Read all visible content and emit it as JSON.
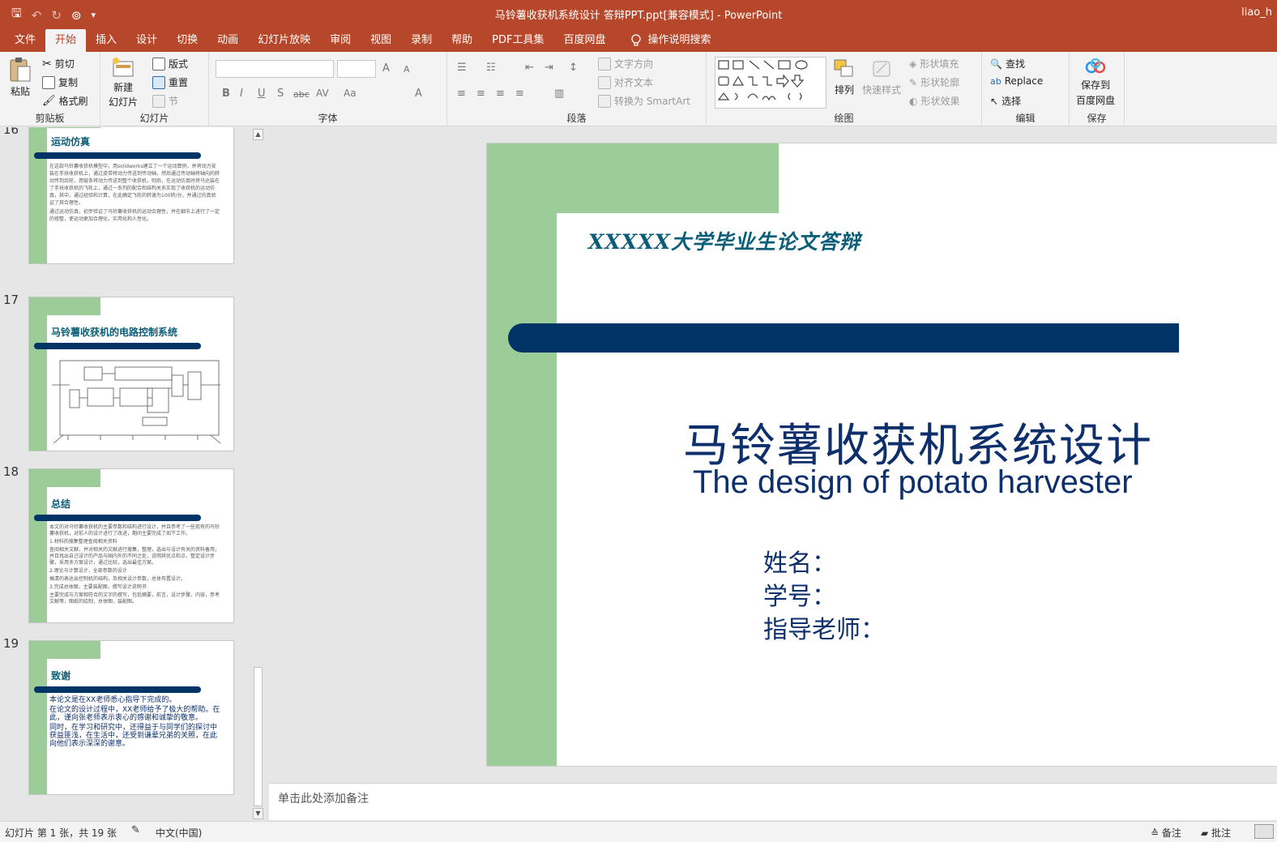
{
  "window": {
    "title": "马铃薯收获机系统设计 答辩PPT.ppt[兼容模式]  -  PowerPoint",
    "user": "liao_h"
  },
  "qat": {
    "save": "🖫",
    "undo": "↶",
    "redo": "↻",
    "present": "⊚",
    "more": "▾"
  },
  "tabs": [
    "文件",
    "开始",
    "插入",
    "设计",
    "切换",
    "动画",
    "幻灯片放映",
    "审阅",
    "视图",
    "录制",
    "帮助",
    "PDF工具集",
    "百度网盘"
  ],
  "active_tab": "开始",
  "tellme": "操作说明搜索",
  "ribbon": {
    "clipboard": {
      "label": "剪贴板",
      "paste": "粘贴",
      "cut": "剪切",
      "copy": "复制",
      "format_painter": "格式刷"
    },
    "slides": {
      "label": "幻灯片",
      "new_slide_1": "新建",
      "new_slide_2": "幻灯片",
      "layout": "版式",
      "reset": "重置",
      "section": "节"
    },
    "font": {
      "label": "字体",
      "bold": "B",
      "italic": "I",
      "underline": "U",
      "shadow": "S",
      "strike": "abc",
      "spacing": "AV",
      "case": "Aa",
      "color": "A",
      "grow": "A",
      "shrink": "A"
    },
    "paragraph": {
      "label": "段落",
      "text_direction": "文字方向",
      "align_text": "对齐文本",
      "smartart": "转换为 SmartArt"
    },
    "drawing": {
      "label": "绘图",
      "arrange": "排列",
      "quick_styles": "快速样式",
      "fill": "形状填充",
      "outline": "形状轮廓",
      "effects": "形状效果"
    },
    "editing": {
      "label": "编辑",
      "find": "查找",
      "replace": "Replace",
      "select": "选择"
    },
    "save": {
      "label": "保存",
      "save_1": "保存到",
      "save_2": "百度网盘"
    }
  },
  "thumbnails": [
    {
      "number": "16",
      "title": "运动仿真",
      "bullets": [
        "在这款马铃薯收获机模型中，用solidworks建立了一个运动算例，并将动力安装在手扶收获机上，通过皮带将动力传送到传动轴，然后通过传动轴将轴向的转动传到齿轮，用链条将动力传送到整个收获机，则后，在运动仿真时将马达装在了手扶收获机的飞轮上，通过一系列的配合和结构关系实现了收获机的运动仿真，其中，通过经验和计算，在此确定飞轮的转速为100转/分，并通过仿真验证了其合理性。",
        "通过运动仿真，初步验证了马铃薯收获机的运动合理性，并在细节上进行了一定的修整，使运动更加合理化，实用化和人性化。"
      ]
    },
    {
      "number": "17",
      "title": "马铃薯收获机的电路控制系统"
    },
    {
      "number": "18",
      "title": "总结",
      "bullets": [
        "本文的对马铃薯收获机的主要参数和结构进行设计，并且参考了一些现有的马铃薯收获机，对前人的设计进行了改进，期间主要完成了如下工作。",
        "1.材料的搜集整理查阅相关资料",
        "查阅相关文献，并对相关的文献进行搜集，整理，选出与设计有关的资料备用，并且找出自己设计的产品与国内外的不同之处，说明其优点和点，整定设计步骤，采用多方案设计，通过比较，选出最佳方案。",
        "2.理论与计算设计，全部参数的设计",
        "搞清的表达出控制机的结构，及相关设计参数，总体布置设计。",
        "3.完成总体图，主要装配图，撰写设计说明书",
        "主要完成与方案相符合的文字的撰写，包括摘要，前言，设计步骤，内容，参考文献等，图纸的绘制，总体图，装配图。"
      ]
    },
    {
      "number": "19",
      "title": "致谢",
      "bullets": [
        "本论文是在XX老师悉心指导下完成的。",
        "在论文的设计过程中，XX老师给予了极大的帮助。在此，谨向张老师表示衷心的感谢和诚挚的敬意。",
        "同时，在学习和研究中，还得益于与同学们的探讨中获益匪浅，在生活中，还受到谦辈兄弟的关照，在此向他们表示深深的谢意。"
      ]
    }
  ],
  "slide": {
    "university": "XXXXX大学毕业生论文答辩",
    "title": "马铃薯收获机系统设计",
    "subtitle": "The design of potato harvester",
    "name_label": "姓名：",
    "id_label": "学号：",
    "advisor_label": "指导老师："
  },
  "notes_placeholder": "单击此处添加备注",
  "status": {
    "slide_info": "幻灯片 第 1 张，共 19 张",
    "language": "中文(中国)",
    "notes": "备注",
    "comments": "批注"
  },
  "colors": {
    "accent": "#b7472a",
    "green": "#9ccc98",
    "navy": "#003366",
    "teal": "#0b5e78"
  }
}
